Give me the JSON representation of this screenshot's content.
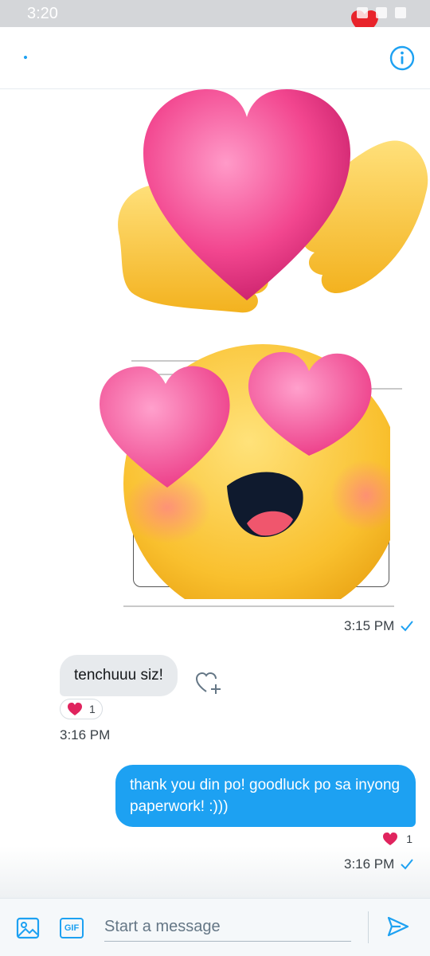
{
  "status_bar": {
    "time": "3:20"
  },
  "conversation": {
    "image_message": {
      "time": "3:15 PM"
    },
    "incoming_message": {
      "text": "tenchuuu siz!",
      "reaction_count": "1",
      "time": "3:16 PM"
    },
    "outgoing_message": {
      "text": "thank you din po! goodluck po sa inyong paperwork! :)))",
      "reaction_count": "1",
      "time": "3:16 PM"
    }
  },
  "composer": {
    "placeholder": "Start a message"
  },
  "icons": {
    "header": [
      "back-icon",
      "info-icon"
    ],
    "composer": [
      "photo-icon",
      "gif-button",
      "send-icon"
    ],
    "message": [
      "heart-icon",
      "add-reaction-icon",
      "check-icon"
    ]
  },
  "colors": {
    "accent": "#1da1f2",
    "incoming_bubble": "#e7eaed",
    "heart_red": "#e0245e",
    "status_bar": "#d4d6d9"
  }
}
